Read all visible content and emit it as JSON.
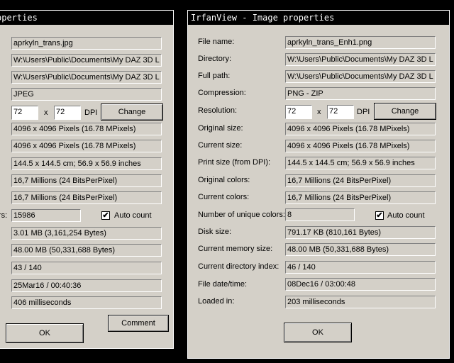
{
  "left": {
    "title_partial": "operties",
    "file_name": "aprkyln_trans.jpg",
    "directory": "W:\\Users\\Public\\Documents\\My DAZ 3D L",
    "full_path": "W:\\Users\\Public\\Documents\\My DAZ 3D L",
    "compression": "JPEG",
    "res_x": "72",
    "res_sep": "x",
    "res_y": "72",
    "dpi": "DPI",
    "change": "Change",
    "original_size": "4096 x 4096  Pixels (16.78 MPixels)",
    "current_size": "4096 x 4096  Pixels (16.78 MPixels)",
    "print_size": "144.5 x 144.5 cm; 56.9 x 56.9 inches",
    "original_colors": "16,7 Millions   (24 BitsPerPixel)",
    "current_colors": "16,7 Millions   (24 BitsPerPixel)",
    "unique_label_partial": "rs:",
    "unique_colors": "15986",
    "auto_count": "Auto count",
    "disk_size": "3.01 MB (3,161,254 Bytes)",
    "memory_size": "48.00  MB (50,331,688 Bytes)",
    "dir_index": "43  /  140",
    "file_date": "25Mar16 / 00:40:36",
    "loaded_in": "406 milliseconds",
    "ok": "OK",
    "comment": "Comment"
  },
  "right": {
    "title": "IrfanView - Image properties",
    "labels": {
      "file_name": "File name:",
      "directory": "Directory:",
      "full_path": "Full path:",
      "compression": "Compression:",
      "resolution": "Resolution:",
      "original_size": "Original size:",
      "current_size": "Current size:",
      "print_size": "Print size (from DPI):",
      "original_colors": "Original colors:",
      "current_colors": "Current colors:",
      "unique_colors": "Number of unique colors:",
      "disk_size": "Disk size:",
      "memory_size": "Current memory size:",
      "dir_index": "Current directory index:",
      "file_date": "File date/time:",
      "loaded_in": "Loaded in:"
    },
    "values": {
      "file_name": "aprkyln_trans_Enh1.png",
      "directory": "W:\\Users\\Public\\Documents\\My DAZ 3D L",
      "full_path": "W:\\Users\\Public\\Documents\\My DAZ 3D L",
      "compression": "PNG - ZIP",
      "res_x": "72",
      "res_sep": "x",
      "res_y": "72",
      "dpi": "DPI",
      "original_size": "4096 x 4096  Pixels (16.78 MPixels)",
      "current_size": "4096 x 4096  Pixels (16.78 MPixels)",
      "print_size": "144.5 x 144.5 cm; 56.9 x 56.9 inches",
      "original_colors": "16,7 Millions   (24 BitsPerPixel)",
      "current_colors": "16,7 Millions   (24 BitsPerPixel)",
      "unique_colors": "8",
      "disk_size": "791.17 KB (810,161 Bytes)",
      "memory_size": "48.00  MB (50,331,688 Bytes)",
      "dir_index": "46  /  140",
      "file_date": "08Dec16 / 03:00:48",
      "loaded_in": "203 milliseconds"
    },
    "change": "Change",
    "auto_count": "Auto count",
    "ok": "OK"
  },
  "checkmark": "✔"
}
